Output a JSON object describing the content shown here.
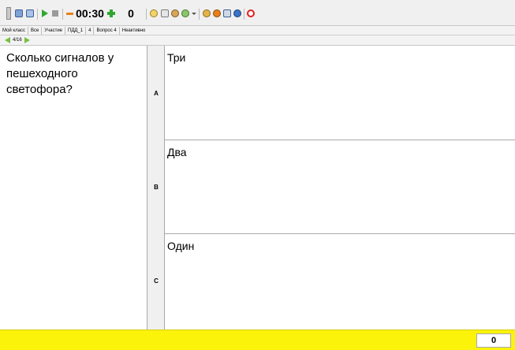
{
  "toolbar": {
    "timer": "00:30",
    "score": "0",
    "colors": {
      "red": "#e02020",
      "green": "#2fa82f",
      "blue": "#3b73c8",
      "orange": "#e8801a",
      "gray": "#9a9a9a"
    },
    "icons": [
      "grip-icon",
      "grid-icon",
      "window-icon",
      "play-icon",
      "stop-icon",
      "minus-icon",
      "plus-icon",
      "tools-icon",
      "list-icon",
      "users-icon",
      "settings-icon",
      "dropdown-icon",
      "person-icon",
      "group-icon",
      "table-icon",
      "help-icon",
      "close-icon"
    ]
  },
  "infobar": {
    "class": "Мой класс",
    "all": "Все",
    "participation": "Участие",
    "subject": "ПДД_1",
    "subject_count": "4",
    "question": "Вопрос 4",
    "status": "Неактивно"
  },
  "nav": {
    "position": "4/16"
  },
  "question": {
    "text": "Сколько сигналов у пешеходного светофора?"
  },
  "answers": [
    {
      "label": "A",
      "text": "Три"
    },
    {
      "label": "B",
      "text": "Два"
    },
    {
      "label": "C",
      "text": "Один"
    }
  ],
  "bottom": {
    "score": "0",
    "bar_color": "#fbf30a"
  }
}
